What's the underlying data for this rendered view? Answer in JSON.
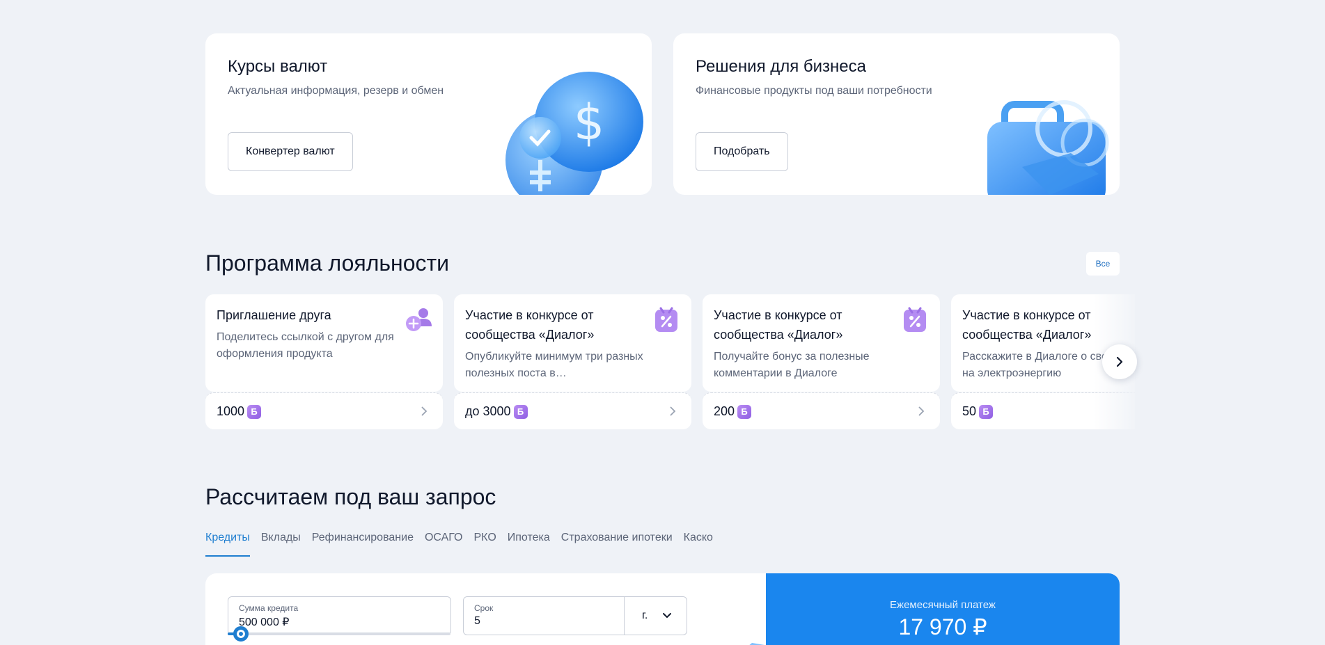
{
  "promo_cards": [
    {
      "title": "Курсы валют",
      "subtitle": "Актуальная информация, резерв и обмен",
      "button": "Конвертер валют",
      "art": "dollar-coins-art"
    },
    {
      "title": "Решения для бизнеса",
      "subtitle": "Финансовые продукты под ваши потребности",
      "button": "Подобрать",
      "art": "briefcase-art"
    }
  ],
  "loyalty": {
    "title": "Программа лояльности",
    "all_label": "Все",
    "badge_letter": "Б",
    "cards": [
      {
        "title": "Приглашение друга",
        "desc": "Поделитесь ссылкой с другом для оформления продукта",
        "points": "1000",
        "icon": "add-user-icon"
      },
      {
        "title": "Участие в конкурсе от сообщества «Диалог»",
        "desc": "Опубликуйте минимум три разных полезных поста в…",
        "points": "до 3000",
        "icon": "percent-ticket-icon"
      },
      {
        "title": "Участие в конкурсе от сообщества «Диалог»",
        "desc": "Получайте бонус за полезные комментарии в Диалоге",
        "points": "200",
        "icon": "percent-ticket-icon"
      },
      {
        "title": "Участие в конкурсе от сообщества «Диалог»",
        "desc": "Расскажите в Диалоге о своих тратах на электроэнергию",
        "points": "50",
        "icon": "percent-ticket-icon"
      }
    ]
  },
  "calculator": {
    "title": "Рассчитаем под ваш запрос",
    "tabs": [
      "Кредиты",
      "Вклады",
      "Рефинансирование",
      "ОСАГО",
      "РКО",
      "Ипотека",
      "Страхование ипотеки",
      "Каско"
    ],
    "active_tab": 0,
    "amount_label": "Сумма кредита",
    "amount_value": "500 000 ₽",
    "amount_slider_fraction": 0.06,
    "term_label": "Срок",
    "term_value": "5",
    "term_unit": "г.",
    "payment_label": "Ежемесячный платеж",
    "payment_value": "17 970 ₽"
  },
  "colors": {
    "accent": "#1f7ed0",
    "payment_panel": "#1a86ee",
    "page_bg": "#eff2f7"
  }
}
